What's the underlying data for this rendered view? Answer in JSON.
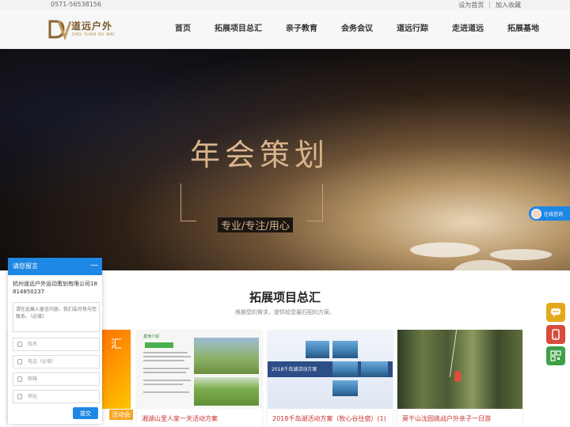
{
  "topbar": {
    "phone": "0571-56538156",
    "set_home": "设为首页",
    "separator": "|",
    "bookmark": "加入收藏"
  },
  "header": {
    "logo": {
      "name": "道远户外",
      "sub": "DAO YUAN HU WAI"
    },
    "nav": [
      {
        "label": "首页"
      },
      {
        "label": "拓展项目总汇"
      },
      {
        "label": "亲子教育"
      },
      {
        "label": "会务会议"
      },
      {
        "label": "道远行踪"
      },
      {
        "label": "走进道远"
      },
      {
        "label": "拓展基地"
      }
    ]
  },
  "banner": {
    "title": "年会策划",
    "subtitle": "专业/专注/用心"
  },
  "online": {
    "label": "在线咨询"
  },
  "section": {
    "title": "拓展项目总汇",
    "subtitle": "根据您的需求，提供给您最匹配的方案。"
  },
  "cards": [
    {
      "image_text": "汇",
      "caption": "活动会"
    },
    {
      "doc_head": "基地介绍",
      "caption": "湘湖山里人家一天活动方案"
    },
    {
      "poster_title": "2018千岛湖活动方案",
      "caption": "2018千岛湖活动方案（牧心谷住宿）(1)"
    },
    {
      "caption": "莫干山沈园挑战户外亲子一日游"
    }
  ],
  "message": {
    "title": "请您留言",
    "minimize": "—",
    "company": "杭州道远户外运动策划有限公司18814850237",
    "placeholder": "请在此输入留言内容，我们会尽快与您联系。（必填）",
    "fields": {
      "name": "姓名",
      "phone": "电话（必填）",
      "email": "邮箱",
      "address": "地址"
    },
    "submit": "提交"
  },
  "colors": {
    "accent": "#1e88e5",
    "caption": "#c9302c",
    "banner_text": "#d9b48b"
  }
}
